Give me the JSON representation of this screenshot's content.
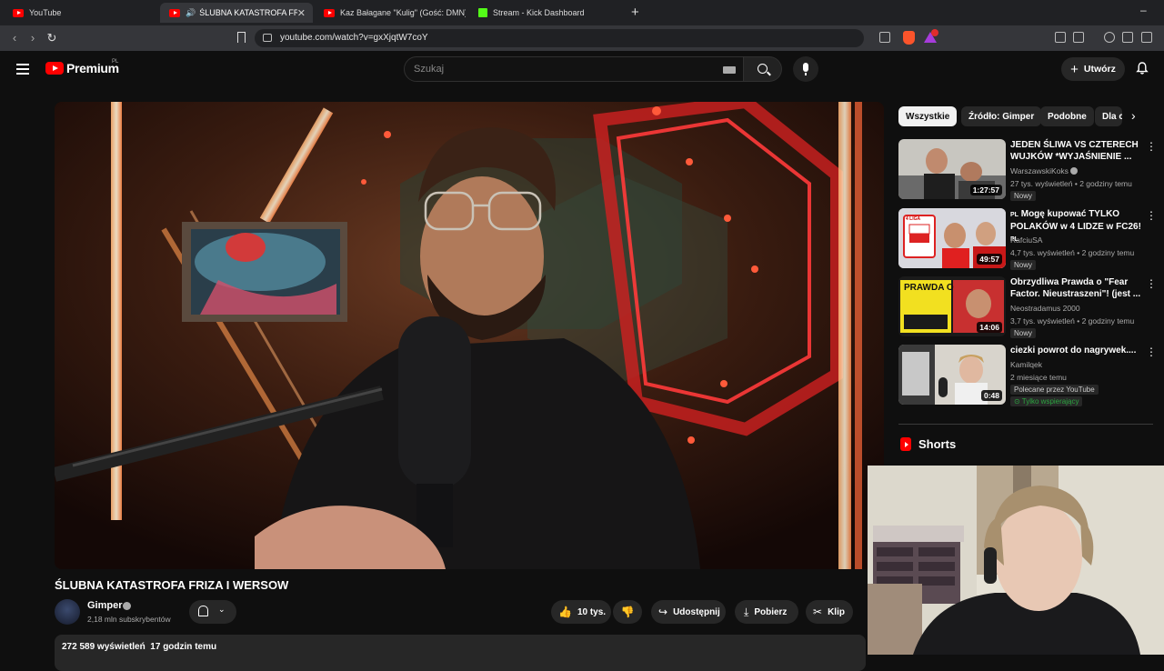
{
  "browser": {
    "tabs": [
      {
        "label": "YouTube",
        "favicon": "youtube-icon"
      },
      {
        "label": "ŚLUBNA KATASTROFA FRIZA I",
        "favicon": "youtube-icon",
        "active": true
      },
      {
        "label": "Kaz Bałagane \"Kulig\" (Gość: DMN)@",
        "favicon": "youtube-icon"
      },
      {
        "label": "Stream - Kick Dashboard",
        "favicon": "kick-icon"
      }
    ],
    "new_tab": "+",
    "minimize": "–",
    "url": "youtube.com/watch?v=gxXjqtW7coY"
  },
  "header": {
    "logo_text": "Premium",
    "logo_sup": "PL",
    "search_placeholder": "Szukaj",
    "create_label": "Utwórz"
  },
  "video": {
    "title": "ŚLUBNA KATASTROFA FRIZA I WERSOW",
    "channel": "Gimper",
    "subscribers": "2,18 mln subskrybentów",
    "likes": "10 tys.",
    "share_label": "Udostępnij",
    "download_label": "Pobierz",
    "clip_label": "Klip",
    "views": "272 589 wyświetleń",
    "uploaded": "17 godzin temu"
  },
  "sidebar": {
    "chips": [
      "Wszystkie",
      "Źródło: Gimper",
      "Podobne",
      "Dla ciebie"
    ],
    "recommendations": [
      {
        "title": "JEDEN ŚLIWA VS CZTERECH WUJKÓW *WYJAŚNIENIE ...",
        "channel": "WarszawskiKoks",
        "views": "27 tys. wyświetleń",
        "age": "2 godziny temu",
        "badge": "Nowy",
        "duration": "1:27:57",
        "verified": true
      },
      {
        "title_prefix": "PL",
        "title": "Mogę kupować TYLKO POLAKÓW w 4 LIDZE w FC26!",
        "title_suffix": "PL",
        "channel": "RafciuSA",
        "views": "4,7 tys. wyświetleń",
        "age": "2 godziny temu",
        "badge": "Nowy",
        "duration": "49:57"
      },
      {
        "title": "Obrzydliwa Prawda o \"Fear Factor. Nieustraszeni\"! (jest ...",
        "channel": "Neostradamus 2000",
        "views": "3,7 tys. wyświetleń",
        "age": "2 godziny temu",
        "badge": "Nowy",
        "duration": "14:06"
      },
      {
        "title": "ciezki powrot do nagrywek....",
        "channel": "Kamilqek",
        "age": "2 miesiące temu",
        "badge": "Polecane przez YouTube",
        "badge2": "Tylko wspierający",
        "duration": "0:48"
      }
    ],
    "thumb2_text": "4 LIGA",
    "thumb3_text": "PRAWDA O",
    "shorts_label": "Shorts"
  },
  "colors": {
    "accent_red": "#ff0000",
    "bg": "#0f0f0f",
    "pill_bg": "#272727",
    "kick_green": "#53fc18"
  }
}
